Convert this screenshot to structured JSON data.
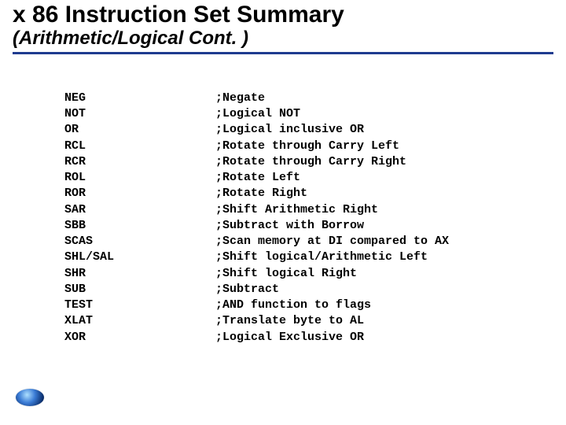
{
  "title": "x 86 Instruction Set Summary",
  "subtitle": "(Arithmetic/Logical Cont. )",
  "instructions": [
    {
      "mnemonic": "NEG",
      "desc": ";Negate"
    },
    {
      "mnemonic": "NOT",
      "desc": ";Logical NOT"
    },
    {
      "mnemonic": "OR",
      "desc": ";Logical inclusive OR"
    },
    {
      "mnemonic": "RCL",
      "desc": ";Rotate through Carry Left"
    },
    {
      "mnemonic": "RCR",
      "desc": ";Rotate through Carry Right"
    },
    {
      "mnemonic": "ROL",
      "desc": ";Rotate Left"
    },
    {
      "mnemonic": "ROR",
      "desc": ";Rotate Right"
    },
    {
      "mnemonic": "SAR",
      "desc": ";Shift Arithmetic Right"
    },
    {
      "mnemonic": "SBB",
      "desc": ";Subtract with Borrow"
    },
    {
      "mnemonic": "SCAS",
      "desc": ";Scan memory at DI compared to AX"
    },
    {
      "mnemonic": "SHL/SAL",
      "desc": ";Shift logical/Arithmetic Left"
    },
    {
      "mnemonic": "SHR",
      "desc": ";Shift logical Right"
    },
    {
      "mnemonic": "SUB",
      "desc": ";Subtract"
    },
    {
      "mnemonic": "TEST",
      "desc": ";AND function to flags"
    },
    {
      "mnemonic": "XLAT",
      "desc": ";Translate byte to AL"
    },
    {
      "mnemonic": "XOR",
      "desc": ";Logical Exclusive OR"
    }
  ],
  "logo": {
    "line1": "",
    "line2": ""
  }
}
